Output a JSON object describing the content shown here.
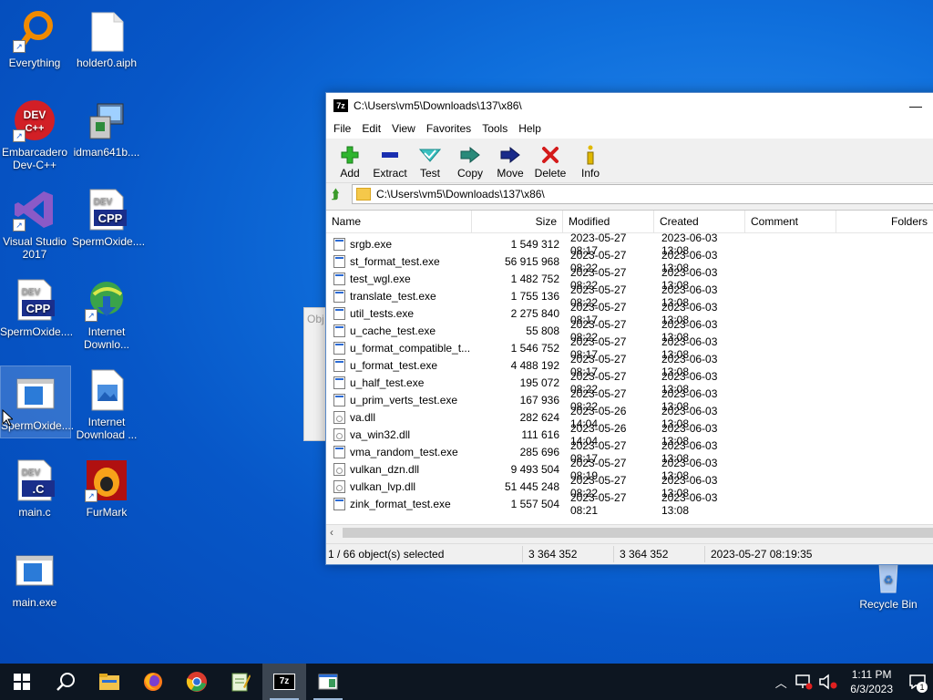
{
  "desktop": {
    "icons": [
      {
        "label": "Everything",
        "icon": "everything-icon"
      },
      {
        "label": "holder0.aiph",
        "icon": "file-icon"
      },
      {
        "label": "Embarcadero Dev-C++",
        "icon": "devcpp-icon"
      },
      {
        "label": "idman641b....",
        "icon": "installer-icon"
      },
      {
        "label": "Visual Studio 2017",
        "icon": "visual-studio-icon"
      },
      {
        "label": "SpermOxide....",
        "icon": "cpp-file-icon"
      },
      {
        "label": "SpermOxide....",
        "icon": "cpp-file-icon"
      },
      {
        "label": "Internet Downlo...",
        "icon": "idm-icon"
      },
      {
        "label": "SpermOxide....",
        "icon": "exe-icon"
      },
      {
        "label": "Internet Download ...",
        "icon": "image-file-icon"
      },
      {
        "label": "main.c",
        "icon": "c-file-icon"
      },
      {
        "label": "FurMark",
        "icon": "furmark-icon"
      },
      {
        "label": "main.exe",
        "icon": "exe-icon"
      },
      {
        "label": "Recycle Bin",
        "icon": "recycle-bin-icon"
      }
    ]
  },
  "behind_window_text": "Obj",
  "window": {
    "app_icon": "7z",
    "title": "C:\\Users\\vm5\\Downloads\\137\\x86\\",
    "minimize": "—",
    "menu": [
      "File",
      "Edit",
      "View",
      "Favorites",
      "Tools",
      "Help"
    ],
    "toolbar": [
      "Add",
      "Extract",
      "Test",
      "Copy",
      "Move",
      "Delete",
      "Info"
    ],
    "address": "C:\\Users\\vm5\\Downloads\\137\\x86\\",
    "columns": [
      "Name",
      "Size",
      "Modified",
      "Created",
      "Comment",
      "Folders"
    ],
    "files": [
      {
        "name": "srgb.exe",
        "size": "1 549 312",
        "modified": "2023-05-27 08:17",
        "created": "2023-06-03 13:08",
        "type": "exe"
      },
      {
        "name": "st_format_test.exe",
        "size": "56 915 968",
        "modified": "2023-05-27 08:22",
        "created": "2023-06-03 13:08",
        "type": "exe"
      },
      {
        "name": "test_wgl.exe",
        "size": "1 482 752",
        "modified": "2023-05-27 08:22",
        "created": "2023-06-03 13:08",
        "type": "exe"
      },
      {
        "name": "translate_test.exe",
        "size": "1 755 136",
        "modified": "2023-05-27 08:22",
        "created": "2023-06-03 13:08",
        "type": "exe"
      },
      {
        "name": "util_tests.exe",
        "size": "2 275 840",
        "modified": "2023-05-27 08:17",
        "created": "2023-06-03 13:08",
        "type": "exe"
      },
      {
        "name": "u_cache_test.exe",
        "size": "55 808",
        "modified": "2023-05-27 08:22",
        "created": "2023-06-03 13:08",
        "type": "exe"
      },
      {
        "name": "u_format_compatible_t...",
        "size": "1 546 752",
        "modified": "2023-05-27 08:17",
        "created": "2023-06-03 13:08",
        "type": "exe"
      },
      {
        "name": "u_format_test.exe",
        "size": "4 488 192",
        "modified": "2023-05-27 08:17",
        "created": "2023-06-03 13:08",
        "type": "exe"
      },
      {
        "name": "u_half_test.exe",
        "size": "195 072",
        "modified": "2023-05-27 08:22",
        "created": "2023-06-03 13:08",
        "type": "exe"
      },
      {
        "name": "u_prim_verts_test.exe",
        "size": "167 936",
        "modified": "2023-05-27 08:22",
        "created": "2023-06-03 13:08",
        "type": "exe"
      },
      {
        "name": "va.dll",
        "size": "282 624",
        "modified": "2023-05-26 14:04",
        "created": "2023-06-03 13:08",
        "type": "dll"
      },
      {
        "name": "va_win32.dll",
        "size": "111 616",
        "modified": "2023-05-26 14:04",
        "created": "2023-06-03 13:08",
        "type": "dll"
      },
      {
        "name": "vma_random_test.exe",
        "size": "285 696",
        "modified": "2023-05-27 08:17",
        "created": "2023-06-03 13:08",
        "type": "exe"
      },
      {
        "name": "vulkan_dzn.dll",
        "size": "9 493 504",
        "modified": "2023-05-27 08:19",
        "created": "2023-06-03 13:08",
        "type": "dll"
      },
      {
        "name": "vulkan_lvp.dll",
        "size": "51 445 248",
        "modified": "2023-05-27 08:22",
        "created": "2023-06-03 13:08",
        "type": "dll"
      },
      {
        "name": "zink_format_test.exe",
        "size": "1 557 504",
        "modified": "2023-05-27 08:21",
        "created": "2023-06-03 13:08",
        "type": "exe"
      }
    ],
    "status": {
      "selected": "1 / 66 object(s) selected",
      "size1": "3 364 352",
      "size2": "3 364 352",
      "date": "2023-05-27 08:19:35"
    }
  },
  "taskbar": {
    "time": "1:11 PM",
    "date": "6/3/2023",
    "notification_count": "1",
    "active_app": "7z"
  }
}
